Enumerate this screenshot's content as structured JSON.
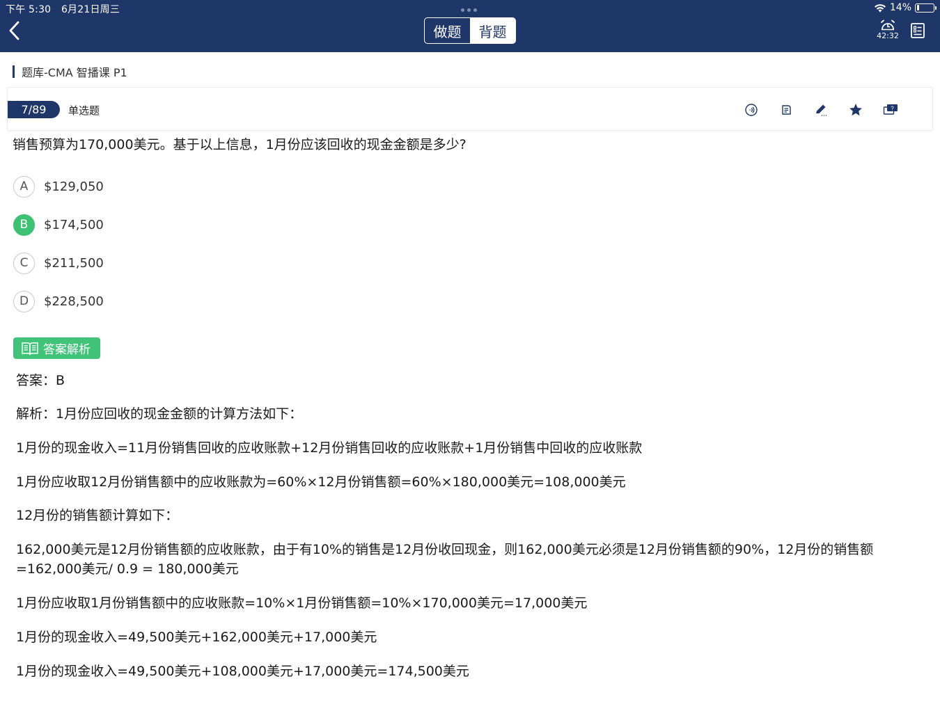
{
  "status": {
    "time": "下午 5:30",
    "date": "6月21日周三",
    "battery": "14%",
    "battery_level": 0.14
  },
  "header": {
    "tab_do": "做题",
    "tab_recite": "背题",
    "active_tab": "背题",
    "timer": "42:32"
  },
  "breadcrumb": "题库-CMA 智播课 P1",
  "question": {
    "progress": "7/89",
    "type": "单选题",
    "text": "销售预算为170,000美元。基于以上信息，1月份应该回收的现金金额是多少?",
    "options": [
      {
        "letter": "A",
        "text": "$129,050"
      },
      {
        "letter": "B",
        "text": "$174,500"
      },
      {
        "letter": "C",
        "text": "$211,500"
      },
      {
        "letter": "D",
        "text": "$228,500"
      }
    ],
    "correct": "B"
  },
  "tools": [
    "audio-icon",
    "note-icon",
    "edit-icon",
    "star-icon",
    "feedback-icon"
  ],
  "analysis": {
    "tag": "答案解析",
    "answer": "答案：B",
    "paragraphs": [
      "解析：1月份应回收的现金金额的计算方法如下：",
      "1月份的现金收入=11月份销售回收的应收账款+12月份销售回收的应收账款+1月份销售中回收的应收账款",
      "1月份应收取12月份销售额中的应收账款为=60%×12月份销售额=60%×180,000美元=108,000美元",
      "12月份的销售额计算如下：",
      "162,000美元是12月份销售额的应收账款，由于有10%的销售是12月份收回现金，则162,000美元必须是12月份销售额的90%，12月份的销售额=162,000美元/ 0.9 = 180,000美元",
      "1月份应收取1月份销售额中的应收账款=10%×1月份销售额=10%×170,000美元=17,000美元",
      "1月份的现金收入=49,500美元+162,000美元+17,000美元",
      "1月份的现金收入=49,500美元+108,000美元+17,000美元=174,500美元"
    ]
  },
  "colors": {
    "header": "#1f3768",
    "correct": "#3ec172",
    "analysis_tag": "#42c37a"
  }
}
